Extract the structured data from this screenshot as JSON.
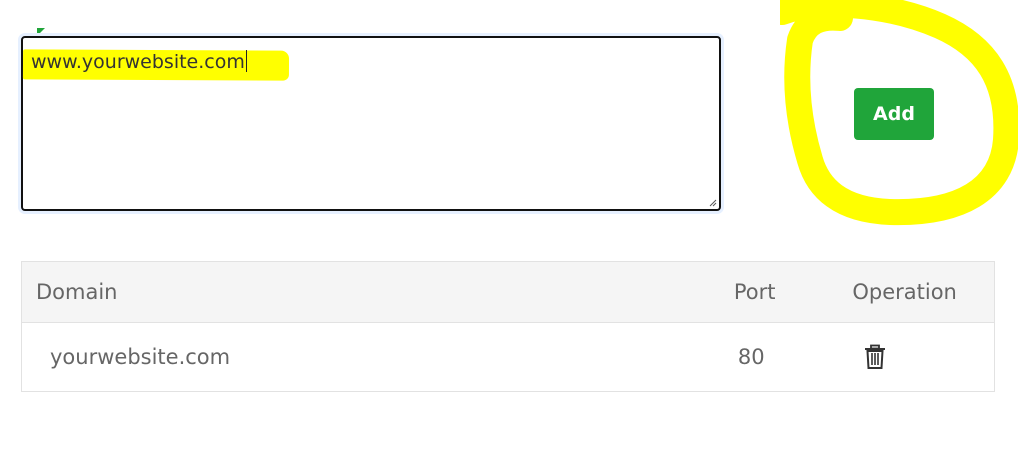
{
  "textarea": {
    "value": "www.yourwebsite.com"
  },
  "add_button": {
    "label": "Add",
    "color": "#20a53a"
  },
  "annotation": {
    "color": "#ffff00",
    "shape": "hand-drawn circle around Add button"
  },
  "table": {
    "columns": [
      "Domain",
      "Port",
      "Operation"
    ],
    "rows": [
      {
        "domain": "yourwebsite.com",
        "port": "80",
        "operation_icon": "trash-icon"
      }
    ]
  }
}
